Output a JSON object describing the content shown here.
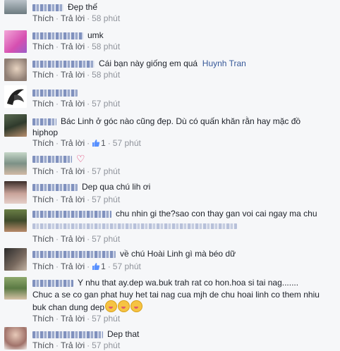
{
  "actions": {
    "like": "Thích",
    "reply": "Trả lời"
  },
  "comments": [
    {
      "text": "Đẹp thế",
      "time": "58 phút"
    },
    {
      "text": "umk",
      "time": "58 phút"
    },
    {
      "text": "Cái bạn này giống em quá",
      "tag": "Huynh Tran",
      "time": "58 phút"
    },
    {
      "text": "",
      "time": "57 phút"
    },
    {
      "text": "Bác Linh ở góc nào cũng đẹp. Dù có quấn khăn rằn hay mặc đồ",
      "text2": "hiphop",
      "likes": "1",
      "time": "57 phút"
    },
    {
      "text": "",
      "time": "57 phút"
    },
    {
      "text": "Dep qua chú lih ơi",
      "time": "57 phút"
    },
    {
      "text": "chu nhin gi the?sao con thay gan voi cai ngay ma chu",
      "time": "57 phút"
    },
    {
      "text": "về chú Hoài Linh gì mà béo dữ",
      "likes": "1",
      "time": "57 phút"
    },
    {
      "text": "Y nhu that ay.dep wa.buk trah rat co hon.hoa si tai nag.......",
      "text2": "Chuc a se co gan phat huy het tai nag cua mjh de chu hoai linh co them nhiu",
      "text3": "buk chan dung dep",
      "time": "57 phút"
    },
    {
      "text": "Dep that",
      "time": "57 phút"
    }
  ],
  "colors": {
    "link": "#365899",
    "meta": "#90949c",
    "background": "#f6f7f9"
  }
}
